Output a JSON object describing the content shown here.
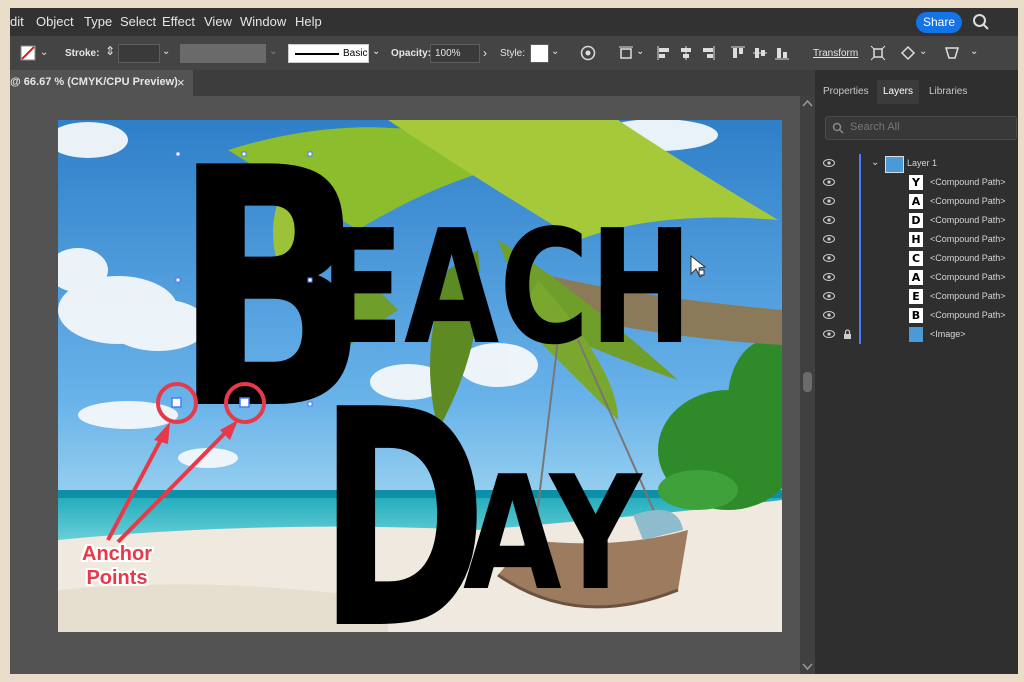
{
  "menu": [
    "dit",
    "Object",
    "Type",
    "Select",
    "Effect",
    "View",
    "Window",
    "Help"
  ],
  "share_label": "Share",
  "control_bar": {
    "stroke_label": "Stroke:",
    "brush_label": "Basic",
    "opacity_label": "Opacity:",
    "opacity_value": "100%",
    "style_label": "Style:",
    "transform_label": "Transform"
  },
  "document_tab": {
    "title": "@ 66.67 % (CMYK/CPU Preview)",
    "close": "×"
  },
  "panel": {
    "tabs": [
      "Properties",
      "Layers",
      "Libraries"
    ],
    "active_tab": "Layers",
    "search_placeholder": "Search All",
    "layer_name": "Layer 1",
    "sublayers": [
      {
        "letter": "Y",
        "name": "<Compound Path>"
      },
      {
        "letter": "A",
        "name": "<Compound Path>"
      },
      {
        "letter": "D",
        "name": "<Compound Path>"
      },
      {
        "letter": "H",
        "name": "<Compound Path>"
      },
      {
        "letter": "C",
        "name": "<Compound Path>"
      },
      {
        "letter": "A",
        "name": "<Compound Path>"
      },
      {
        "letter": "E",
        "name": "<Compound Path>"
      },
      {
        "letter": "B",
        "name": "<Compound Path>"
      },
      {
        "letter": "",
        "name": "<Image>"
      }
    ]
  },
  "artwork": {
    "big_letters": [
      "B",
      "D"
    ],
    "line1_rest": "EACH",
    "line2_rest": "AY"
  },
  "annotation": {
    "line1": "Anchor",
    "line2": "Points"
  },
  "colors": {
    "accent_blue": "#1473e6",
    "annotation_red": "#e8394b",
    "layer_blue": "#4a7cf7"
  }
}
